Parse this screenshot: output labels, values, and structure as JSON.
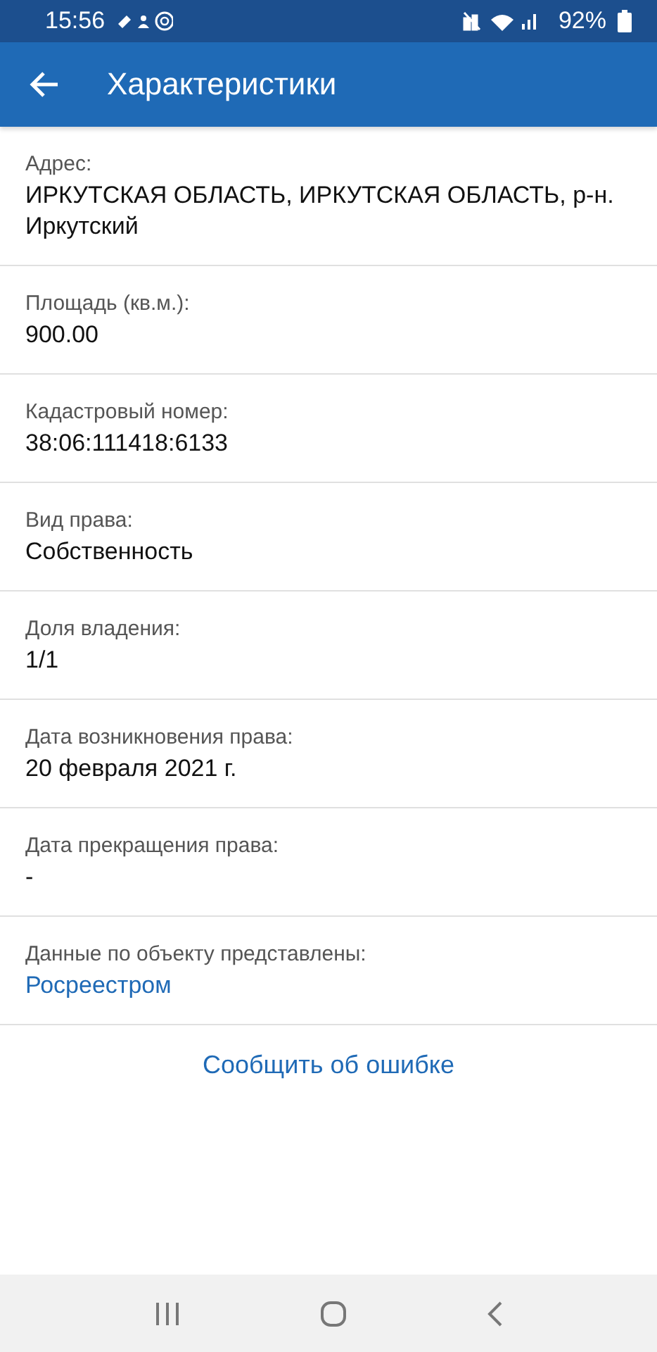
{
  "status_bar": {
    "time": "15:56",
    "battery": "92%"
  },
  "app_bar": {
    "title": "Характеристики"
  },
  "fields": [
    {
      "label": "Адрес:",
      "value": "ИРКУТСКАЯ ОБЛАСТЬ, ИРКУТСКАЯ ОБЛАСТЬ, р-н. Иркутский",
      "kind": "text"
    },
    {
      "label": "Площадь (кв.м.):",
      "value": "900.00",
      "kind": "text"
    },
    {
      "label": "Кадастровый номер:",
      "value": "38:06:111418:6133",
      "kind": "text"
    },
    {
      "label": "Вид права:",
      "value": "Собственность",
      "kind": "text"
    },
    {
      "label": "Доля владения:",
      "value": "1/1",
      "kind": "text"
    },
    {
      "label": "Дата возникновения права:",
      "value": "20 февраля 2021 г.",
      "kind": "text"
    },
    {
      "label": "Дата прекращения права:",
      "value": "-",
      "kind": "text"
    },
    {
      "label": "Данные по объекту представлены:",
      "value": "Росреестром",
      "kind": "link"
    }
  ],
  "report_link": "Сообщить об ошибке"
}
